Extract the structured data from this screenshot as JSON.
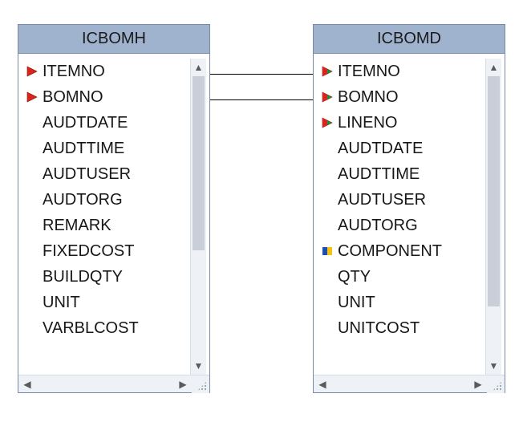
{
  "tables": {
    "left": {
      "title": "ICBOMH",
      "fields": [
        {
          "name": "ITEMNO",
          "key": "pk"
        },
        {
          "name": "BOMNO",
          "key": "pk"
        },
        {
          "name": "AUDTDATE",
          "key": null
        },
        {
          "name": "AUDTTIME",
          "key": null
        },
        {
          "name": "AUDTUSER",
          "key": null
        },
        {
          "name": "AUDTORG",
          "key": null
        },
        {
          "name": "REMARK",
          "key": null
        },
        {
          "name": "FIXEDCOST",
          "key": null
        },
        {
          "name": "BUILDQTY",
          "key": null
        },
        {
          "name": "UNIT",
          "key": null
        },
        {
          "name": "VARBLCOST",
          "key": null
        }
      ]
    },
    "right": {
      "title": "ICBOMD",
      "fields": [
        {
          "name": "ITEMNO",
          "key": "fk"
        },
        {
          "name": "BOMNO",
          "key": "fk"
        },
        {
          "name": "LINENO",
          "key": "fk"
        },
        {
          "name": "AUDTDATE",
          "key": null
        },
        {
          "name": "AUDTTIME",
          "key": null
        },
        {
          "name": "AUDTUSER",
          "key": null
        },
        {
          "name": "AUDTORG",
          "key": null
        },
        {
          "name": "COMPONENT",
          "key": "ix"
        },
        {
          "name": "QTY",
          "key": null
        },
        {
          "name": "UNIT",
          "key": null
        },
        {
          "name": "UNITCOST",
          "key": null
        }
      ]
    }
  },
  "colors": {
    "header_bg": "#9fb3cf",
    "pk_fill": "#d8261c",
    "fk_fill": "#179a3c",
    "ix_left": "#1f4fb3",
    "ix_right": "#f4c40f"
  }
}
